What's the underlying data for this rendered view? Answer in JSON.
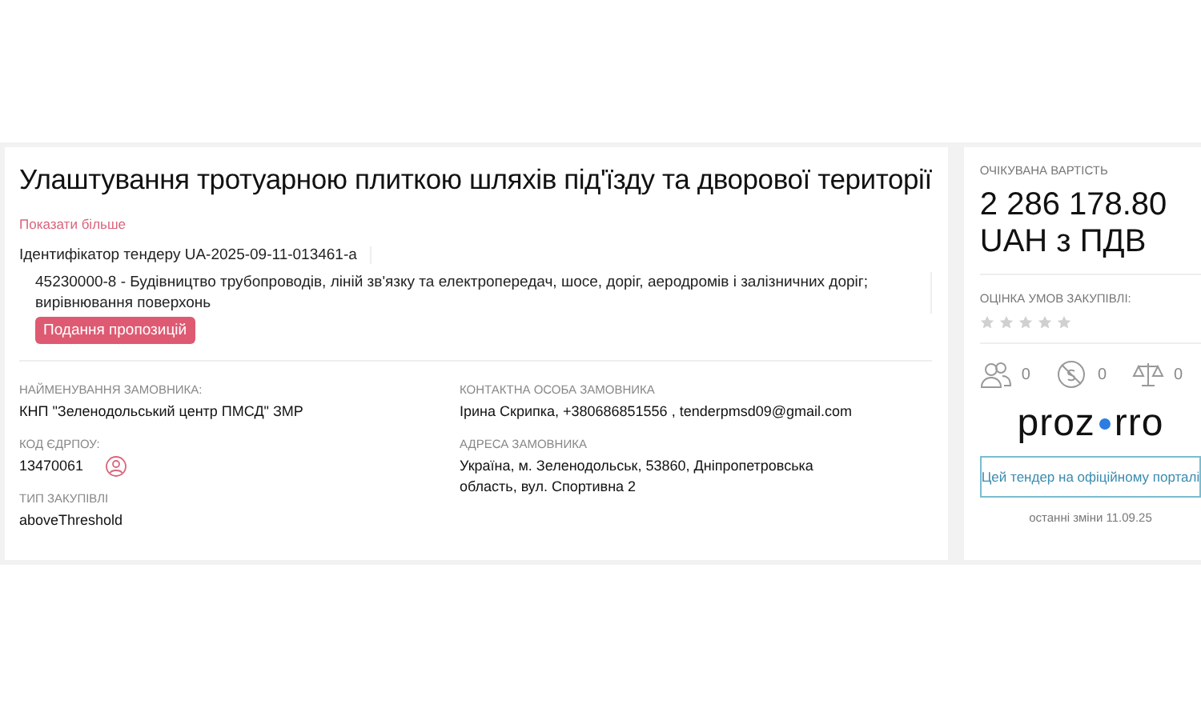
{
  "tender": {
    "title": "Улаштування тротуарною плиткою шляхів під'їзду та дворової території",
    "show_more": "Показати більше",
    "identifier": "Ідентифікатор тендеру UA-2025-09-11-013461-a",
    "classification": "45230000-8 - Будівництво трубопроводів, ліній зв'язку та електропередач, шосе, доріг, аеродромів і залізничних доріг; вирівнювання поверхонь",
    "status_badge": "Подання пропозицій"
  },
  "details_left": [
    {
      "label": "НАЙМЕНУВАННЯ ЗАМОВНИКА:",
      "value": "КНП \"Зеленодольський центр ПМСД\" ЗМР",
      "kind": "text"
    },
    {
      "label": "КОД ЄДРПОУ:",
      "value": "13470061",
      "kind": "with_icon"
    },
    {
      "label": "ТИП ЗАКУПІВЛІ",
      "value": "aboveThreshold",
      "kind": "text"
    }
  ],
  "details_right": [
    {
      "label": "КОНТАКТНА ОСОБА ЗАМОВНИКА",
      "value": "Ірина Скрипка, +380686851556 , tenderpmsd09@gmail.com",
      "kind": "text"
    },
    {
      "label": "АДРЕСА ЗАМОВНИКА",
      "value": "Україна, м. Зеленодольськ, 53860, Дніпропетровська область, вул. Спортивна 2",
      "kind": "text"
    }
  ],
  "sidebar": {
    "value_label": "ОЧІКУВАНА ВАРТІСТЬ",
    "amount": "2 286 178.80",
    "currency": "UAH з ПДВ",
    "rating_label": "ОЦІНКА УМОВ ЗАКУПІВЛІ:",
    "stars": 0,
    "counters": [
      {
        "kind": "participants",
        "count": "0"
      },
      {
        "kind": "no_money",
        "count": "0"
      },
      {
        "kind": "complaints",
        "count": "0"
      }
    ],
    "logo": {
      "left": "proz",
      "right": "rro"
    },
    "portal_button": "Цей тендер на офіційному порталі",
    "last_change": "останні зміни 11.09.25"
  }
}
